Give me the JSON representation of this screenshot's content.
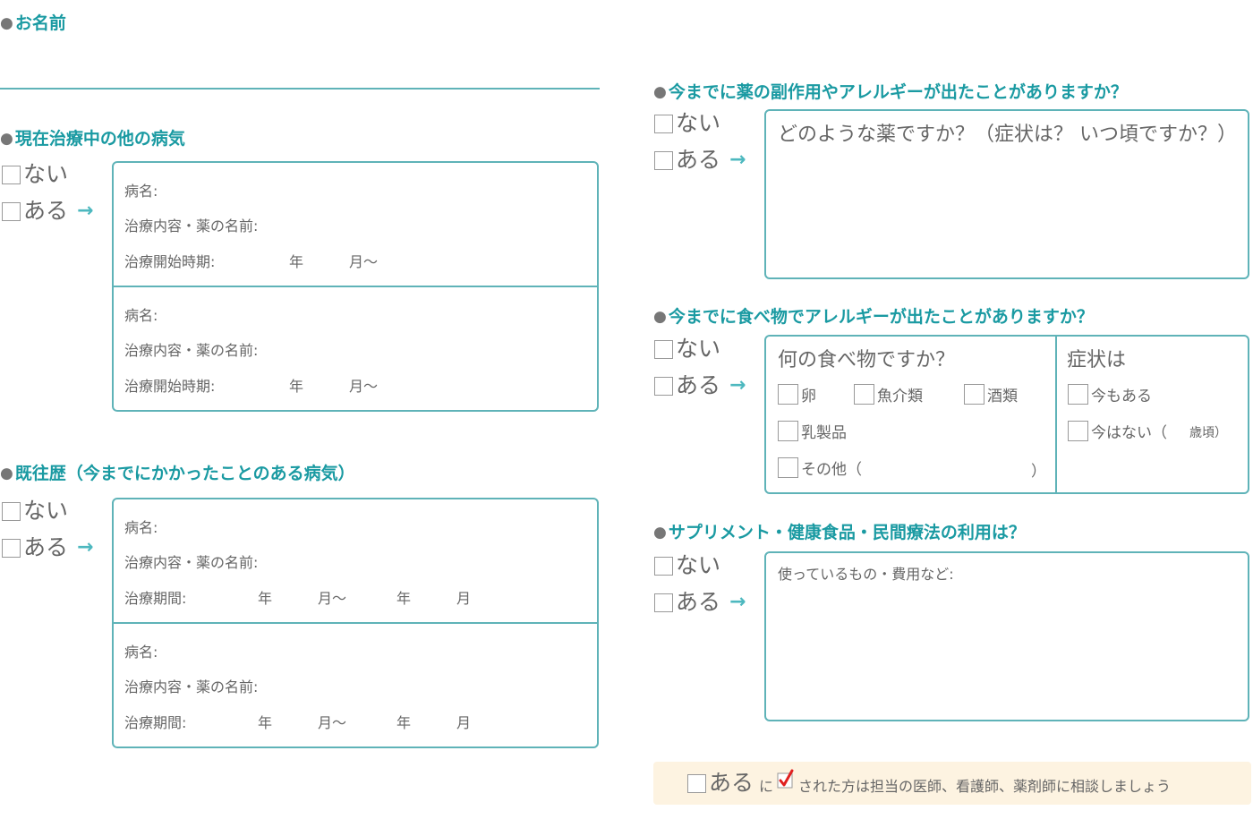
{
  "name_section": {
    "heading": "お名前"
  },
  "current_illness": {
    "heading": "現在治療中の他の病気",
    "options": [
      "ない",
      "ある"
    ],
    "entries": [
      {
        "disease_label": "病名:",
        "treatment_label": "治療内容・薬の名前:",
        "start_label": "治療開始時期:",
        "year": "年",
        "month": "月～"
      },
      {
        "disease_label": "病名:",
        "treatment_label": "治療内容・薬の名前:",
        "start_label": "治療開始時期:",
        "year": "年",
        "month": "月～"
      }
    ]
  },
  "past_history": {
    "heading": "既往歴（今までにかかったことのある病気）",
    "options": [
      "ない",
      "ある"
    ],
    "entries": [
      {
        "disease_label": "病名:",
        "treatment_label": "治療内容・薬の名前:",
        "period_label": "治療期間:",
        "year_from": "年",
        "month_from": "月～",
        "year_to": "年",
        "month_to": "月"
      },
      {
        "disease_label": "病名:",
        "treatment_label": "治療内容・薬の名前:",
        "period_label": "治療期間:",
        "year_from": "年",
        "month_from": "月～",
        "year_to": "年",
        "month_to": "月"
      }
    ]
  },
  "drug_allergy": {
    "heading": "今までに薬の副作用やアレルギーが出たことがありますか？",
    "options": [
      "ない",
      "ある"
    ],
    "prompt": "どのような薬ですか？（症状は？ いつ頃ですか？）"
  },
  "food_allergy": {
    "heading": "今までに食べ物でアレルギーが出たことがありますか？",
    "options": [
      "ない",
      "ある"
    ],
    "food_prompt": "何の食べ物ですか？",
    "foods": [
      "卵",
      "魚介類",
      "酒類",
      "乳製品",
      "その他（",
      "）"
    ],
    "symptom_prompt": "症状は",
    "symptoms": [
      "今もある",
      "今はない（",
      "歳頃）"
    ]
  },
  "supplements": {
    "heading": "サプリメント・健康食品・民間療法の利用は？",
    "options": [
      "ない",
      "ある"
    ],
    "prompt": "使っているもの・費用など:"
  },
  "footer_note": {
    "option_label": "ある",
    "connector": "に",
    "text": "された方は担当の医師、看護師、薬剤師に相談しましょう"
  }
}
